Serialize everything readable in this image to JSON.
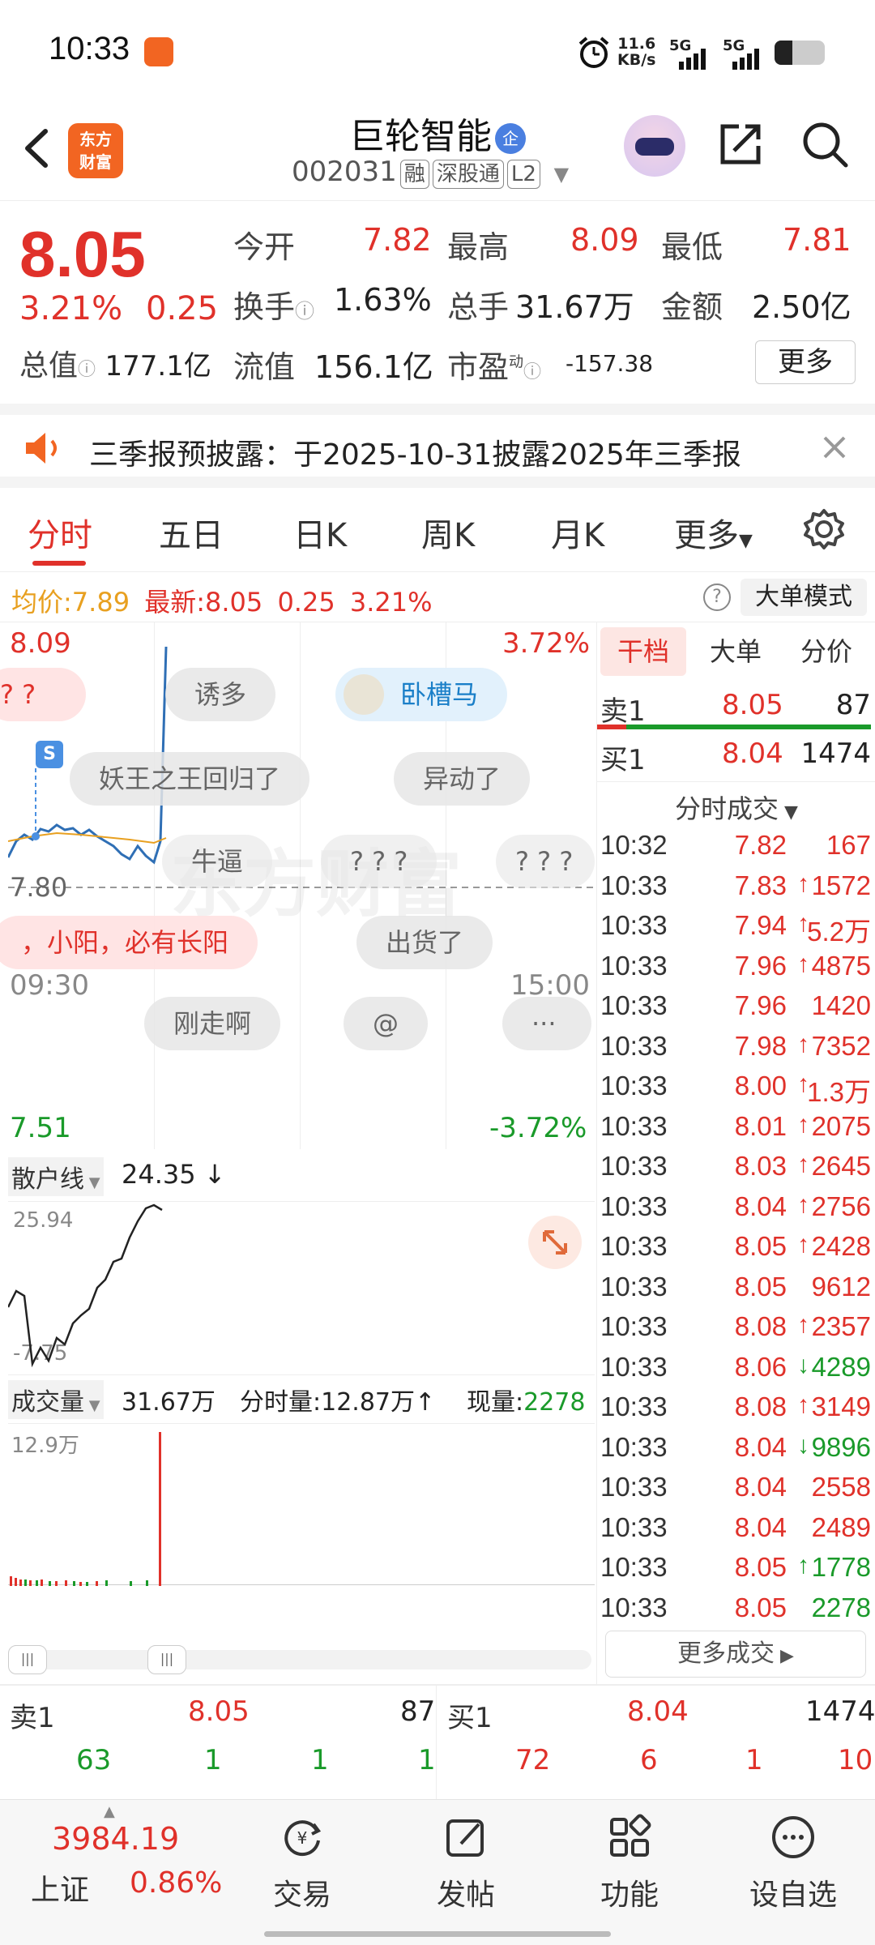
{
  "status": {
    "time": "10:33",
    "net_speed": "11.6",
    "net_unit": "KB/s",
    "sig1": "5G",
    "sig2": "5G",
    "battery_level": 0.35
  },
  "header": {
    "logo_line1": "东方",
    "logo_line2": "财富",
    "stock_name": "巨轮智能",
    "ent_badge": "企",
    "code": "002031",
    "tags": [
      "融",
      "深股通",
      "L2"
    ]
  },
  "quote": {
    "price": "8.05",
    "change_pct": "3.21%",
    "change_abs": "0.25",
    "fields": [
      {
        "label": "今开",
        "value": "7.82",
        "color": "#e0312a"
      },
      {
        "label": "最高",
        "value": "8.09",
        "color": "#e0312a"
      },
      {
        "label": "最低",
        "value": "7.81",
        "color": "#e0312a"
      },
      {
        "label": "换手",
        "value": "1.63%",
        "color": "#222222"
      },
      {
        "label": "总手",
        "value": "31.67万",
        "color": "#222222"
      },
      {
        "label": "金额",
        "value": "2.50亿",
        "color": "#222222"
      }
    ],
    "total_value_label": "总值",
    "total_value": "177.1亿",
    "float_value_label": "流值",
    "float_value": "156.1亿",
    "pe_label": "市盈",
    "pe_sup": "动",
    "pe_value": "-157.38",
    "more_label": "更多"
  },
  "notice": {
    "text": "三季报预披露：于2025-10-31披露2025年三季报"
  },
  "tabs": [
    "分时",
    "五日",
    "日K",
    "周K",
    "月K",
    "更多"
  ],
  "info_line": {
    "avg_label": "均价:",
    "avg_value": "7.89",
    "latest_label": "最新:",
    "latest_value": "8.05",
    "latest_chg": "0.25",
    "latest_pct": "3.21%",
    "help": "?",
    "mode_button": "大单模式"
  },
  "main_chart": {
    "high_label": "8.09",
    "high_pct": "3.72%",
    "mid_label": "7.80",
    "low_label": "7.51",
    "low_pct": "-3.72%",
    "watermark": "东方财富",
    "marker": "S",
    "bubbles": [
      "? ?",
      "诱多",
      "卧槽马",
      "妖王之王回归了",
      "异动了",
      "牛逼",
      "? ? ?",
      "? ? ?",
      "，小阳，必有长阳",
      "出货了",
      "刚走啊",
      "@",
      "···"
    ]
  },
  "sub_chart": {
    "name": "散户线",
    "value": "24.35",
    "arrow": "↓",
    "top": "25.94",
    "bottom": "-7.75"
  },
  "volume": {
    "name": "成交量",
    "total": "31.67万",
    "minute_label": "分时量:",
    "minute_value": "12.87万",
    "minute_arrow": "↑",
    "now_label": "现量:",
    "now_value": "2278",
    "scale": "12.9万",
    "time_start": "09:30",
    "time_end": "15:00"
  },
  "right_panel": {
    "tabs": [
      "干档",
      "大单",
      "分价"
    ],
    "ask1_label": "卖1",
    "ask1_price": "8.05",
    "ask1_vol": "87",
    "bid1_label": "买1",
    "bid1_price": "8.04",
    "bid1_vol": "1474",
    "ticks_title": "分时成交",
    "ticks": [
      {
        "t": "10:32",
        "p": "7.82",
        "a": "",
        "v": "167",
        "c": "red"
      },
      {
        "t": "10:33",
        "p": "7.83",
        "a": "↑",
        "v": "1572",
        "c": "red"
      },
      {
        "t": "10:33",
        "p": "7.94",
        "a": "↑",
        "v": "5.2万",
        "c": "red"
      },
      {
        "t": "10:33",
        "p": "7.96",
        "a": "↑",
        "v": "4875",
        "c": "red"
      },
      {
        "t": "10:33",
        "p": "7.96",
        "a": "",
        "v": "1420",
        "c": "red"
      },
      {
        "t": "10:33",
        "p": "7.98",
        "a": "↑",
        "v": "7352",
        "c": "red"
      },
      {
        "t": "10:33",
        "p": "8.00",
        "a": "↑",
        "v": "1.3万",
        "c": "red"
      },
      {
        "t": "10:33",
        "p": "8.01",
        "a": "↑",
        "v": "2075",
        "c": "red"
      },
      {
        "t": "10:33",
        "p": "8.03",
        "a": "↑",
        "v": "2645",
        "c": "red"
      },
      {
        "t": "10:33",
        "p": "8.04",
        "a": "↑",
        "v": "2756",
        "c": "red"
      },
      {
        "t": "10:33",
        "p": "8.05",
        "a": "↑",
        "v": "2428",
        "c": "red"
      },
      {
        "t": "10:33",
        "p": "8.05",
        "a": "",
        "v": "9612",
        "c": "red"
      },
      {
        "t": "10:33",
        "p": "8.08",
        "a": "↑",
        "v": "2357",
        "c": "red"
      },
      {
        "t": "10:33",
        "p": "8.06",
        "a": "↓",
        "v": "4289",
        "c": "green"
      },
      {
        "t": "10:33",
        "p": "8.08",
        "a": "↑",
        "v": "3149",
        "c": "red"
      },
      {
        "t": "10:33",
        "p": "8.04",
        "a": "↓",
        "v": "9896",
        "c": "green"
      },
      {
        "t": "10:33",
        "p": "8.04",
        "a": "",
        "v": "2558",
        "c": "red"
      },
      {
        "t": "10:33",
        "p": "8.04",
        "a": "",
        "v": "2489",
        "c": "red"
      },
      {
        "t": "10:33",
        "p": "8.05",
        "a": "↑",
        "v": "1778",
        "c": "green"
      },
      {
        "t": "10:33",
        "p": "8.05",
        "a": "",
        "v": "2278",
        "c": "green"
      }
    ],
    "more_deals": "更多成交"
  },
  "bottom_book": {
    "ask_label": "卖1",
    "ask_price": "8.05",
    "ask_vol": "87",
    "bid_label": "买1",
    "bid_price": "8.04",
    "bid_vol": "1474",
    "ask_queue": [
      "63",
      "1",
      "1",
      "1"
    ],
    "bid_queue": [
      "72",
      "6",
      "1",
      "10"
    ]
  },
  "bottom_nav": {
    "index_value": "3984.19",
    "index_name": "上证",
    "index_pct": "0.86%",
    "items": [
      "交易",
      "发帖",
      "功能",
      "设自选"
    ]
  }
}
